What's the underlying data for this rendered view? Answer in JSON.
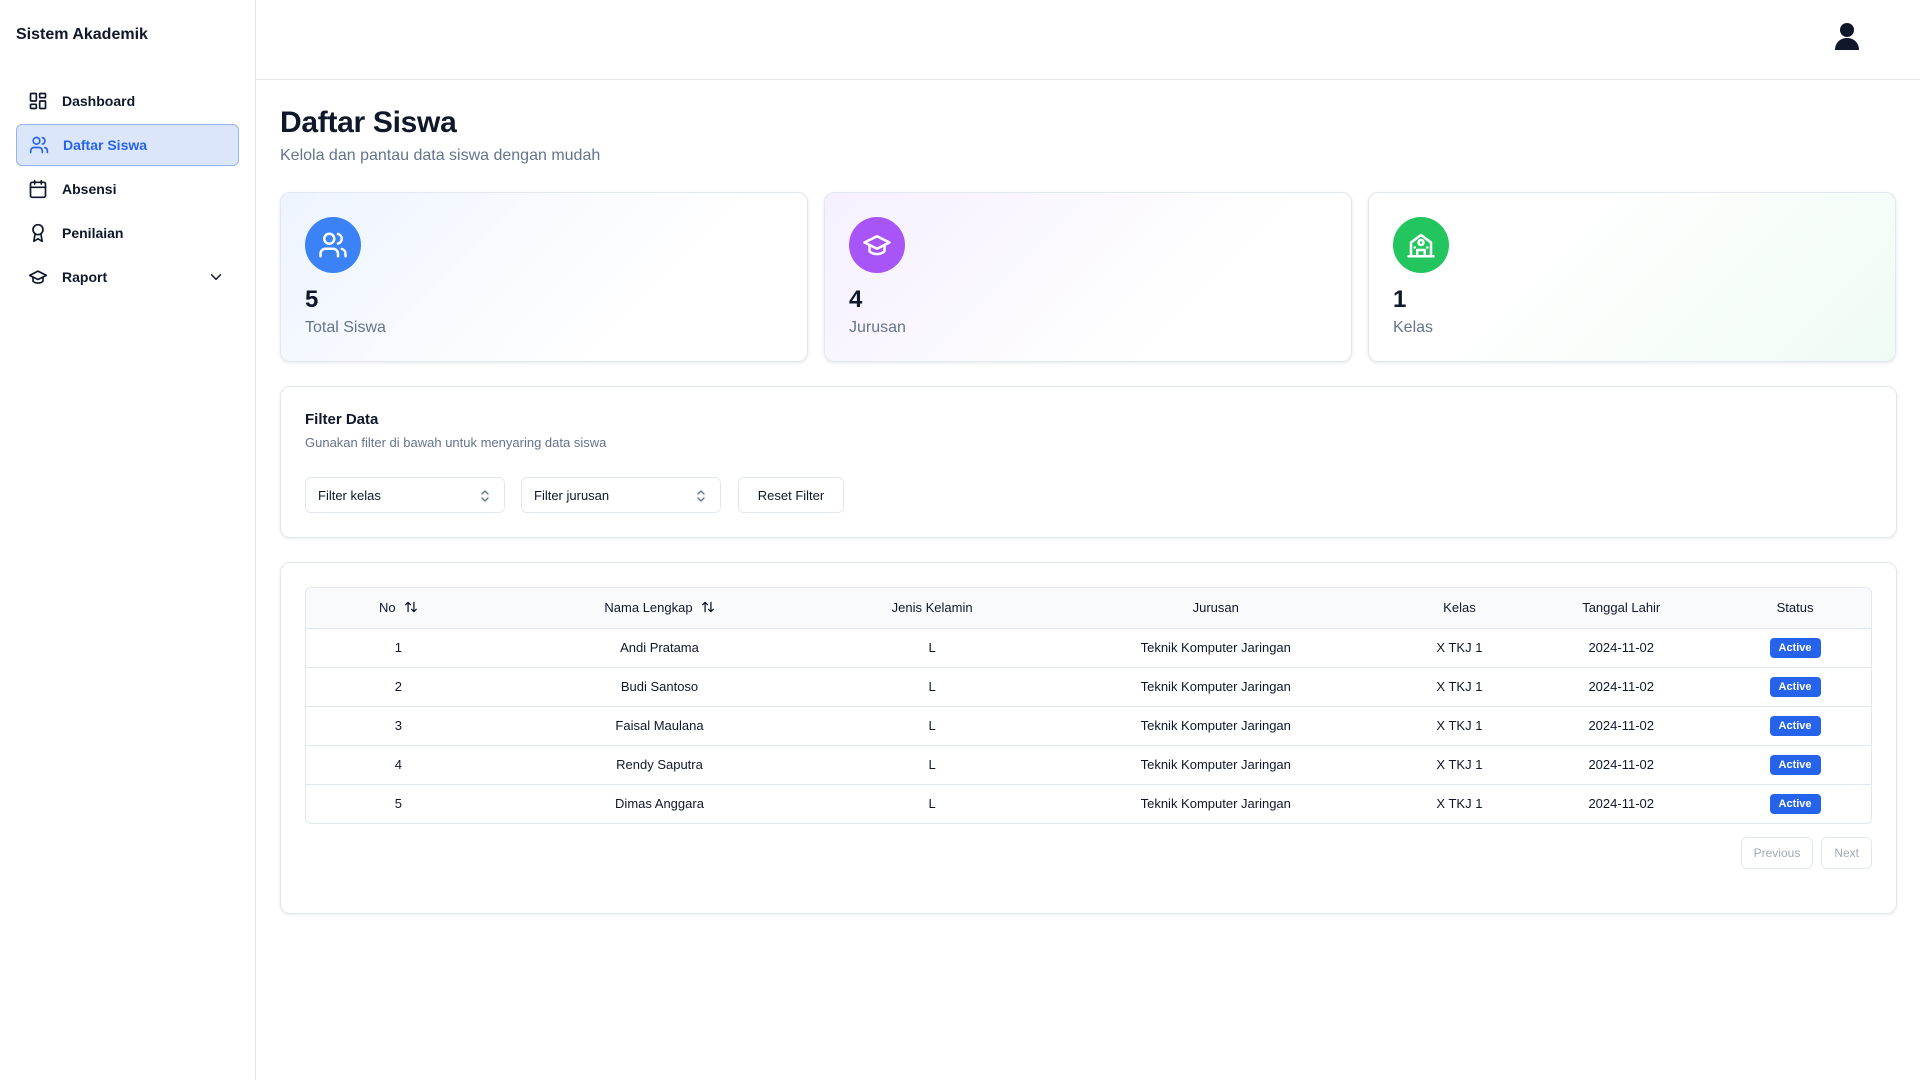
{
  "app": {
    "title": "Sistem Akademik"
  },
  "sidebar": {
    "items": [
      {
        "label": "Dashboard",
        "icon": "dashboard-grid-icon",
        "active": false
      },
      {
        "label": "Daftar Siswa",
        "icon": "users-icon",
        "active": true
      },
      {
        "label": "Absensi",
        "icon": "calendar-icon",
        "active": false
      },
      {
        "label": "Penilaian",
        "icon": "award-icon",
        "active": false
      },
      {
        "label": "Raport",
        "icon": "graduation-cap-icon",
        "active": false,
        "expandable": true
      }
    ]
  },
  "header": {
    "user_icon": "user-icon"
  },
  "page": {
    "title": "Daftar Siswa",
    "subtitle": "Kelola dan pantau data siswa dengan mudah"
  },
  "stats": [
    {
      "value": "5",
      "label": "Total Siswa",
      "icon": "users-icon",
      "color": "#3b82f6"
    },
    {
      "value": "4",
      "label": "Jurusan",
      "icon": "graduation-cap-icon",
      "color": "#a855f7"
    },
    {
      "value": "1",
      "label": "Kelas",
      "icon": "school-icon",
      "color": "#22c55e"
    }
  ],
  "filter": {
    "title": "Filter Data",
    "description": "Gunakan filter di bawah untuk menyaring data siswa",
    "kelas_placeholder": "Filter kelas",
    "jurusan_placeholder": "Filter jurusan",
    "reset_label": "Reset Filter"
  },
  "table": {
    "columns": [
      "No",
      "Nama Lengkap",
      "Jenis Kelamin",
      "Jurusan",
      "Kelas",
      "Tanggal Lahir",
      "Status"
    ],
    "rows": [
      {
        "no": "1",
        "nama": "Andi Pratama",
        "jk": "L",
        "jurusan": "Teknik Komputer Jaringan",
        "kelas": "X TKJ 1",
        "tgl": "2024-11-02",
        "status": "Active"
      },
      {
        "no": "2",
        "nama": "Budi Santoso",
        "jk": "L",
        "jurusan": "Teknik Komputer Jaringan",
        "kelas": "X TKJ 1",
        "tgl": "2024-11-02",
        "status": "Active"
      },
      {
        "no": "3",
        "nama": "Faisal Maulana",
        "jk": "L",
        "jurusan": "Teknik Komputer Jaringan",
        "kelas": "X TKJ 1",
        "tgl": "2024-11-02",
        "status": "Active"
      },
      {
        "no": "4",
        "nama": "Rendy Saputra",
        "jk": "L",
        "jurusan": "Teknik Komputer Jaringan",
        "kelas": "X TKJ 1",
        "tgl": "2024-11-02",
        "status": "Active"
      },
      {
        "no": "5",
        "nama": "Dimas Anggara",
        "jk": "L",
        "jurusan": "Teknik Komputer Jaringan",
        "kelas": "X TKJ 1",
        "tgl": "2024-11-02",
        "status": "Active"
      }
    ],
    "status_color": "#2563eb"
  },
  "pagination": {
    "previous": "Previous",
    "next": "Next"
  },
  "colors": {
    "accent": "#2563eb",
    "active_nav_bg": "#dbe6fb"
  }
}
